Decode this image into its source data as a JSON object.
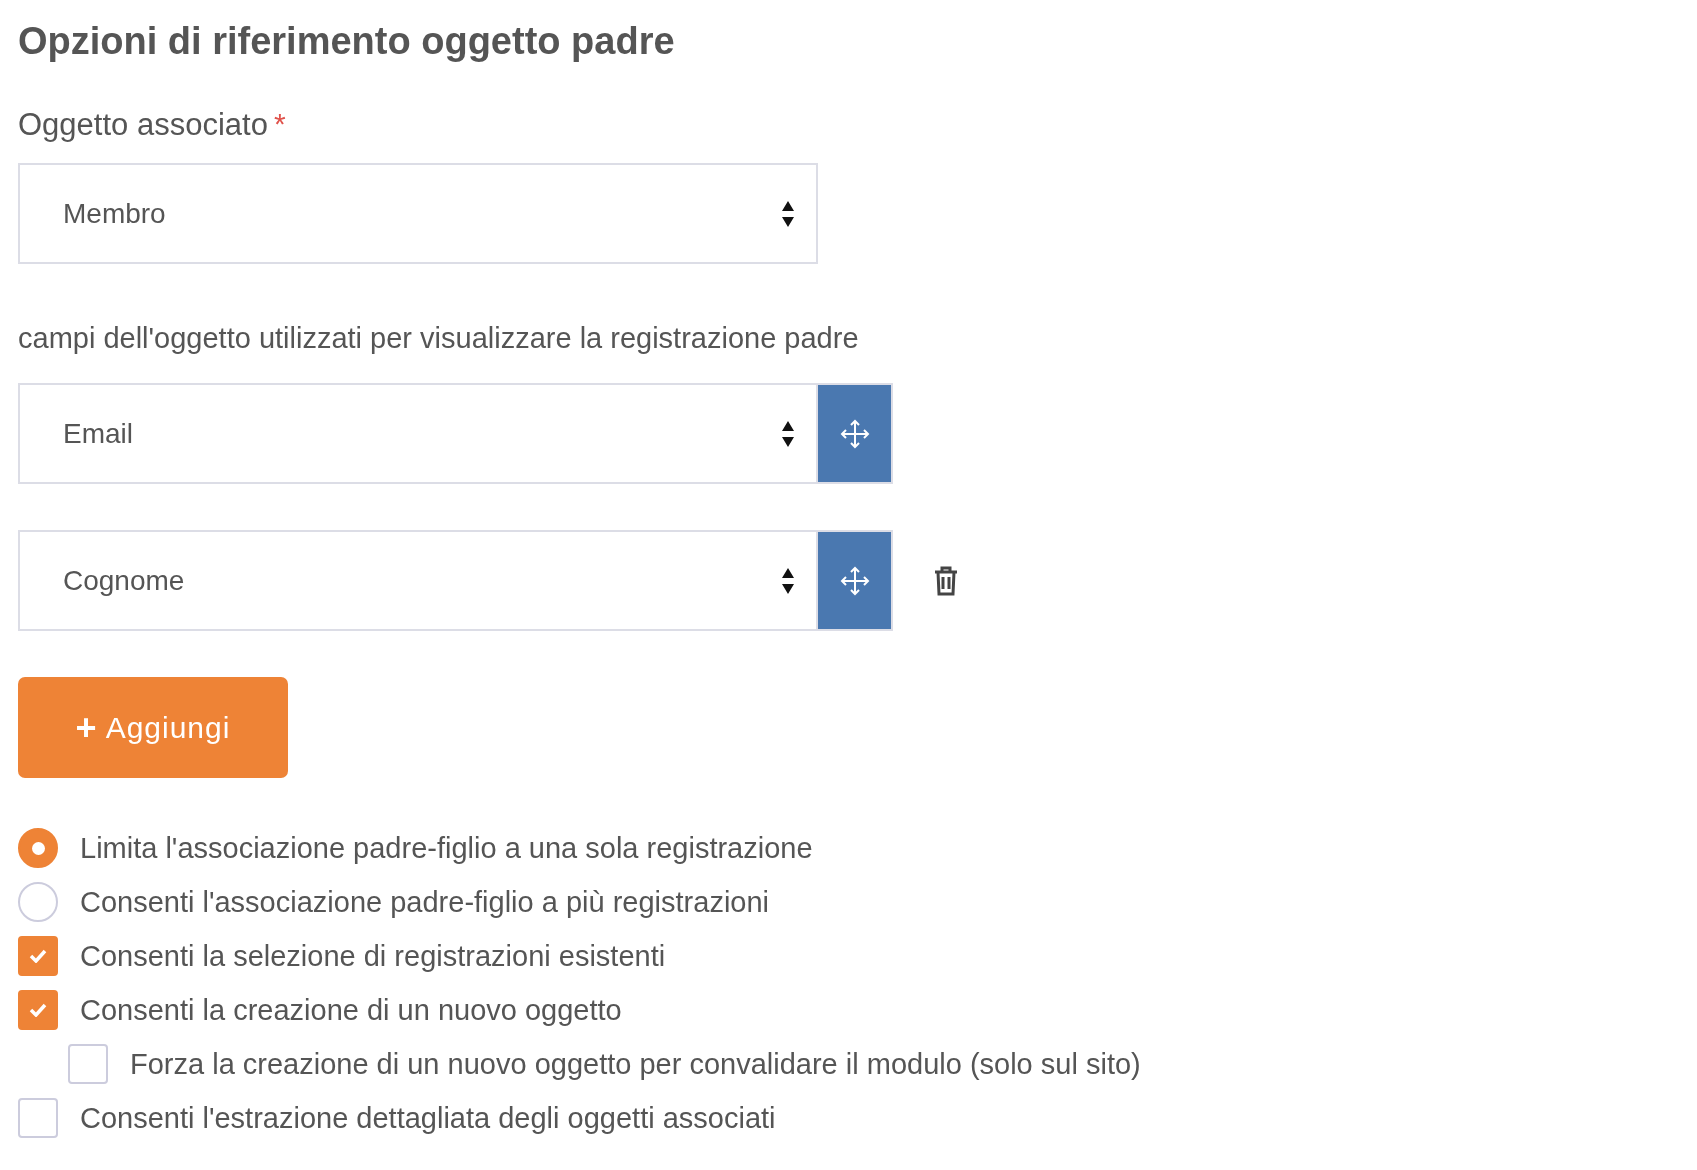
{
  "title": "Opzioni di riferimento oggetto padre",
  "object_field": {
    "label": "Oggetto associato",
    "required_mark": "*",
    "value": "Membro"
  },
  "display_fields": {
    "label": "campi dell'oggetto utilizzati per visualizzare la registrazione padre",
    "items": [
      {
        "value": "Email",
        "deletable": false
      },
      {
        "value": "Cognome",
        "deletable": true
      }
    ]
  },
  "add_button": {
    "icon": "+",
    "label": "Aggiungi"
  },
  "options": [
    {
      "kind": "radio",
      "label": "Limita l'associazione padre-figlio a una sola registrazione",
      "selected": true
    },
    {
      "kind": "radio",
      "label": "Consenti l'associazione padre-figlio a più registrazioni",
      "selected": false
    },
    {
      "kind": "checkbox",
      "label": "Consenti la selezione di registrazioni esistenti",
      "checked": true
    },
    {
      "kind": "checkbox",
      "label": "Consenti la creazione di un nuovo oggetto",
      "checked": true,
      "children": [
        {
          "kind": "checkbox",
          "label": "Forza la creazione di un nuovo oggetto per convalidare il modulo (solo sul sito)",
          "checked": false
        }
      ]
    },
    {
      "kind": "checkbox",
      "label": "Consenti l'estrazione dettagliata degli oggetti associati",
      "checked": false
    }
  ]
}
